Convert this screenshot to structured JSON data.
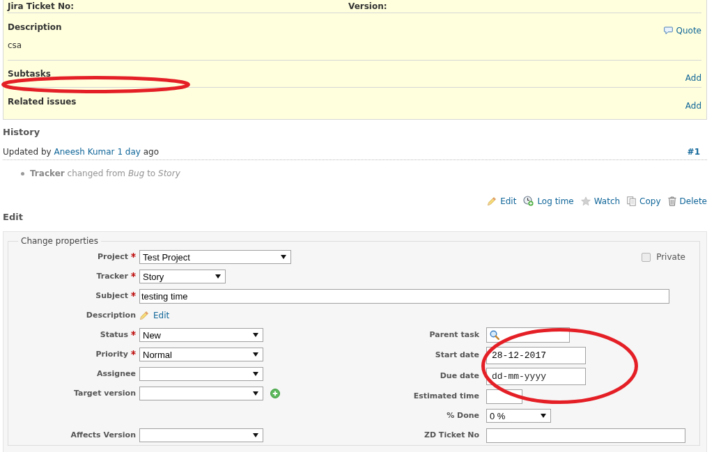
{
  "issue": {
    "top_fields": [
      {
        "label": "Jira Ticket No:"
      },
      {
        "label": "Version:"
      }
    ],
    "description": {
      "heading": "Description",
      "quote": "Quote",
      "text": "csa"
    },
    "sections": [
      {
        "heading": "Subtasks",
        "action": "Add"
      },
      {
        "heading": "Related issues",
        "action": "Add"
      }
    ]
  },
  "history": {
    "heading": "History",
    "journals": [
      {
        "updated_by": "Updated by",
        "author": "Aneesh Kumar",
        "age": "1 day",
        "ago": "ago",
        "number": "#1",
        "changes": [
          "**Tracker** changed from *Bug* to *Story*"
        ]
      }
    ]
  },
  "actions": [
    {
      "kind": "edit",
      "label": "Edit"
    },
    {
      "kind": "log_time",
      "label": "Log time"
    },
    {
      "kind": "watch",
      "label": "Watch"
    },
    {
      "kind": "copy",
      "label": "Copy"
    },
    {
      "kind": "delete",
      "label": "Delete"
    }
  ],
  "edit": {
    "heading": "Edit",
    "legend": "Change properties",
    "private": {
      "label": "Private",
      "checked": false
    },
    "main_fields": [
      {
        "kind": "select",
        "label": "Project",
        "required": true,
        "value": "Test Project"
      },
      {
        "kind": "select",
        "label": "Tracker",
        "required": true,
        "value": "Story"
      },
      {
        "kind": "text",
        "label": "Subject",
        "required": true,
        "value": "testing time"
      },
      {
        "kind": "edit_link",
        "label": "Description",
        "required": false,
        "link": "Edit"
      }
    ],
    "left_fields": [
      {
        "kind": "select",
        "label": "Status",
        "required": true,
        "value": "New",
        "addable": false
      },
      {
        "kind": "select",
        "label": "Priority",
        "required": true,
        "value": "Normal",
        "addable": false
      },
      {
        "kind": "select",
        "label": "Assignee",
        "required": false,
        "addable": false
      },
      {
        "kind": "select",
        "label": "Target version",
        "required": false,
        "addable": true
      }
    ],
    "right_fields": [
      {
        "kind": "search",
        "label": "Parent task",
        "required": false
      },
      {
        "kind": "date",
        "label": "Start date",
        "required": false,
        "value": "28-12-2017"
      },
      {
        "kind": "date",
        "label": "Due date",
        "required": false,
        "placeholder": "dd-mm-yyyy"
      },
      {
        "kind": "text",
        "label": "Estimated time",
        "required": false
      },
      {
        "kind": "select",
        "label": "% Done",
        "required": false,
        "value": "0 %"
      }
    ],
    "custom_left": [
      {
        "kind": "select",
        "label": "Affects Version",
        "required": false
      }
    ],
    "custom_right": [
      {
        "kind": "text",
        "label": "ZD Ticket No",
        "required": false
      }
    ]
  }
}
